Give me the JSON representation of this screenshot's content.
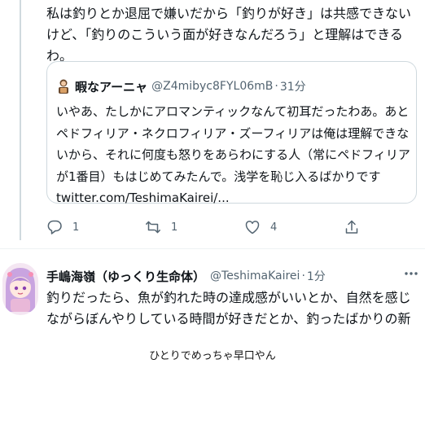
{
  "tweet": {
    "text": "私は釣りとか退屈で嫌いだから「釣りが好き」は共感できないけど、「釣りのこういう面が好きなんだろう」と理解はできるわ。"
  },
  "quote": {
    "display_name": "暇なアーニャ",
    "handle": "@Z4mibyc8FYL06mB",
    "separator": "·",
    "time": "31分",
    "text": "いやあ、たしかにアロマンティックなんて初耳だったわあ。あとペドフィリア・ネクロフィリア・ズーフィリアは俺は理解できないから、それに何度も怒りをあらわにする人（常にペドフィリアが1番目）もはじめてみたんで。浅学を恥じ入るばかりです ",
    "link": "twitter.com/TeshimaKairei/..."
  },
  "actions": {
    "reply_icon": "reply-icon",
    "reply_count": "1",
    "retweet_icon": "retweet-icon",
    "retweet_count": "1",
    "like_icon": "like-icon",
    "like_count": "4",
    "share_icon": "share-icon"
  },
  "reply_tweet": {
    "display_name": "手嶋海嶺（ゆっくり生命体）",
    "handle": "@TeshimaKairei",
    "separator": "·",
    "time": "1分",
    "text": "釣りだったら、魚が釣れた時の達成感がいいとか、自然を感じながらぼんやりしている時間が好きだとか、釣ったばかりの新鮮な魚を捌いて食べる"
  },
  "caption": "ひとりでめっちゃ早口やん",
  "colors": {
    "text": "#0f1419",
    "secondary": "#536471",
    "border": "#cfd9de"
  }
}
